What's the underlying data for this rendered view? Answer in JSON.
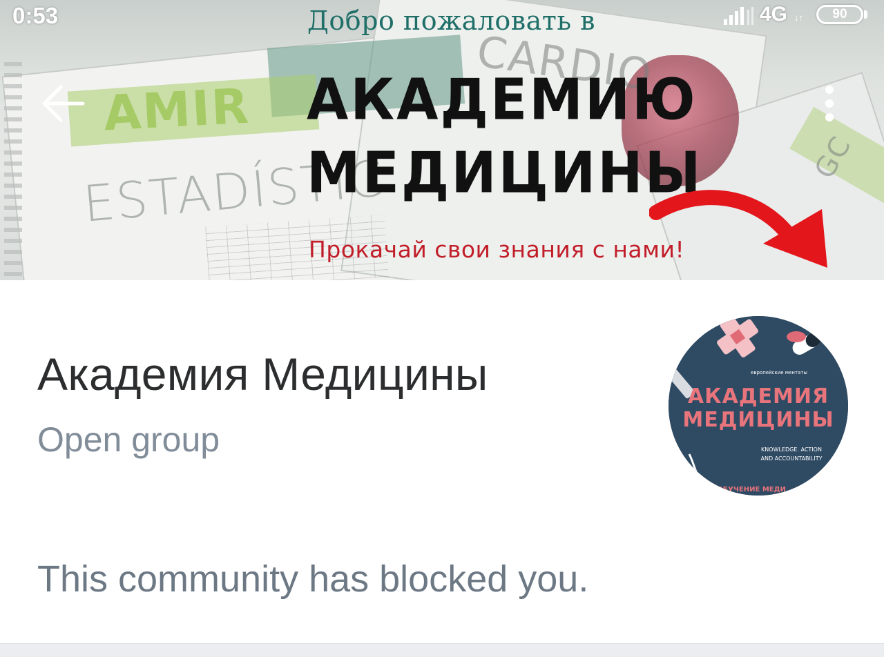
{
  "status_bar": {
    "time": "0:53",
    "network": "4G",
    "network_arrows": "↓↑",
    "battery": "90"
  },
  "cover": {
    "welcome_line": "Добро пожаловать в",
    "headline_line1": "АКАДЕМИЮ",
    "headline_line2": "МЕДИЦИНЫ",
    "tagline": "Прокачай свои знания с нами!",
    "background_words": {
      "amir": "AMIR",
      "estadistica": "ESTADÍSTIC",
      "cardio": "CARDIO",
      "gc": "GC"
    },
    "accent_color": "#c21e2a",
    "welcome_color": "#1f6f68"
  },
  "toolbar": {
    "back_icon": "arrow-left-icon",
    "more_icon": "more-vertical-icon"
  },
  "group": {
    "name": "Академия Медицины",
    "type": "Open group",
    "avatar": {
      "top_small": "европейские ментаты",
      "title_line1": "АКАДЕМИЯ",
      "title_line2": "МЕДИЦИНЫ",
      "motto_line1": "KNOWLEDGE. ACTION",
      "motto_line2": "AND ACCOUNTABILITY",
      "bottom_text": "ОБУЧЕНИЕ МЕДИ",
      "background_color": "#2f4a63",
      "title_color": "#e8747c"
    }
  },
  "messages": {
    "blocked": "This community has blocked you."
  }
}
